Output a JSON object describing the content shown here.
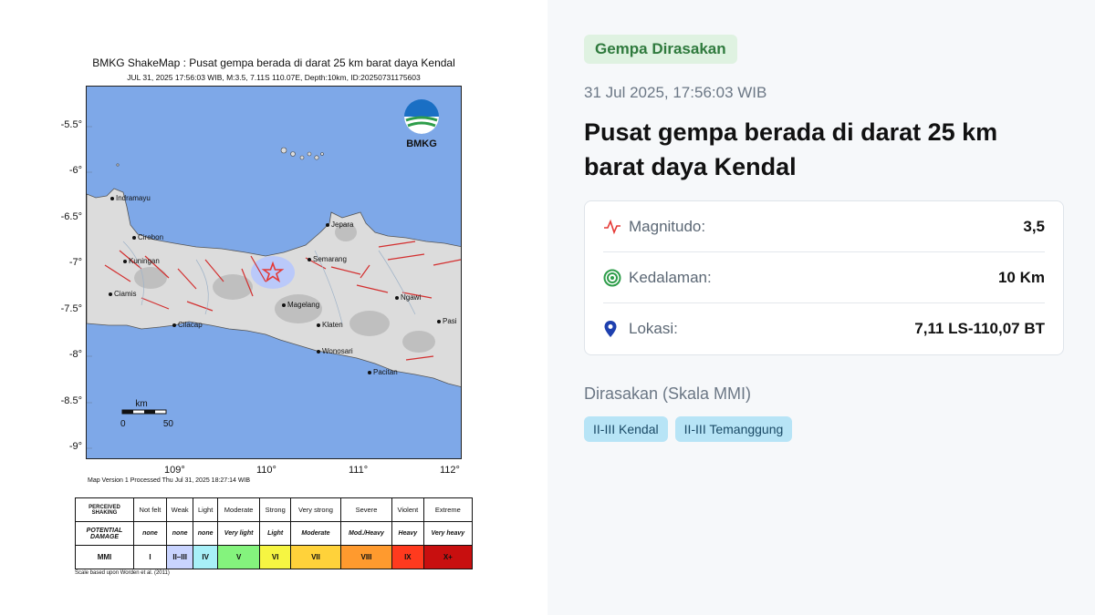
{
  "shakemap": {
    "title": "BMKG ShakeMap : Pusat gempa berada di darat 25 km barat daya Kendal",
    "subtitle": "JUL 31, 2025 17:56:03 WIB, M:3.5, 7.11S 110.07E, Depth:10km, ID:20250731175603",
    "lat_ticks": [
      "-5.5°",
      "-6°",
      "-6.5°",
      "-7°",
      "-7.5°",
      "-8°",
      "-8.5°",
      "-9°"
    ],
    "lon_ticks": [
      "109°",
      "110°",
      "111°",
      "112°"
    ],
    "logo_text": "BMKG",
    "scale_unit": "km",
    "scale_min": "0",
    "scale_max": "50",
    "version_text": "Map Version 1 Processed Thu Jul 31, 2025 18:27:14 WIB",
    "scale_note": "Scale based upon Worden et al. (2011)",
    "cities": [
      "Indramayu",
      "Cirebon",
      "Kuningan",
      "Ciamis",
      "Cilacap",
      "Jepara",
      "Semarang",
      "Magelang",
      "Klaten",
      "Wonosari",
      "Ngawi",
      "Pacitan",
      "Pasi"
    ],
    "epicenter_icon": "star-icon",
    "colors": {
      "sea": "#7ea8e8",
      "land": "#d9d9d9",
      "fault": "#d32f2f",
      "epicenter": "#e53935"
    }
  },
  "mmi_table": {
    "row_labels": [
      "PERCEIVED SHAKING",
      "POTENTIAL DAMAGE",
      "MMI"
    ],
    "shaking": [
      "Not felt",
      "Weak",
      "Light",
      "Moderate",
      "Strong",
      "Very strong",
      "Severe",
      "Violent",
      "Extreme"
    ],
    "damage": [
      "none",
      "none",
      "none",
      "Very light",
      "Light",
      "Moderate",
      "Mod./Heavy",
      "Heavy",
      "Very heavy"
    ],
    "levels": [
      "I",
      "II–III",
      "IV",
      "V",
      "VI",
      "VII",
      "VIII",
      "IX",
      "X+"
    ],
    "level_colors": [
      "#ffffff",
      "#c9d4ff",
      "#a8f0f8",
      "#84f37d",
      "#f6f542",
      "#ffd23a",
      "#ff9a2e",
      "#ff3a1e",
      "#c80f0f"
    ]
  },
  "info": {
    "badge": "Gempa Dirasakan",
    "datetime": "31 Jul 2025, 17:56:03 WIB",
    "headline": "Pusat gempa berada di darat 25 km barat daya Kendal",
    "rows": [
      {
        "icon": "pulse-icon",
        "label": "Magnitudo:",
        "value": "3,5"
      },
      {
        "icon": "target-icon",
        "label": "Kedalaman:",
        "value": "10 Km"
      },
      {
        "icon": "map-pin-icon",
        "label": "Lokasi:",
        "value": "7,11 LS-110,07 BT"
      }
    ],
    "felt_title": "Dirasakan (Skala MMI)",
    "felt_chips": [
      "II-III Kendal",
      "II-III Temanggung"
    ],
    "colors": {
      "badge_bg": "#dff2e1",
      "badge_text": "#2f7a3d",
      "chip_bg": "#b7e4f6",
      "pulse": "#e53935",
      "target": "#2e9d4a",
      "pin": "#1e40af"
    }
  }
}
